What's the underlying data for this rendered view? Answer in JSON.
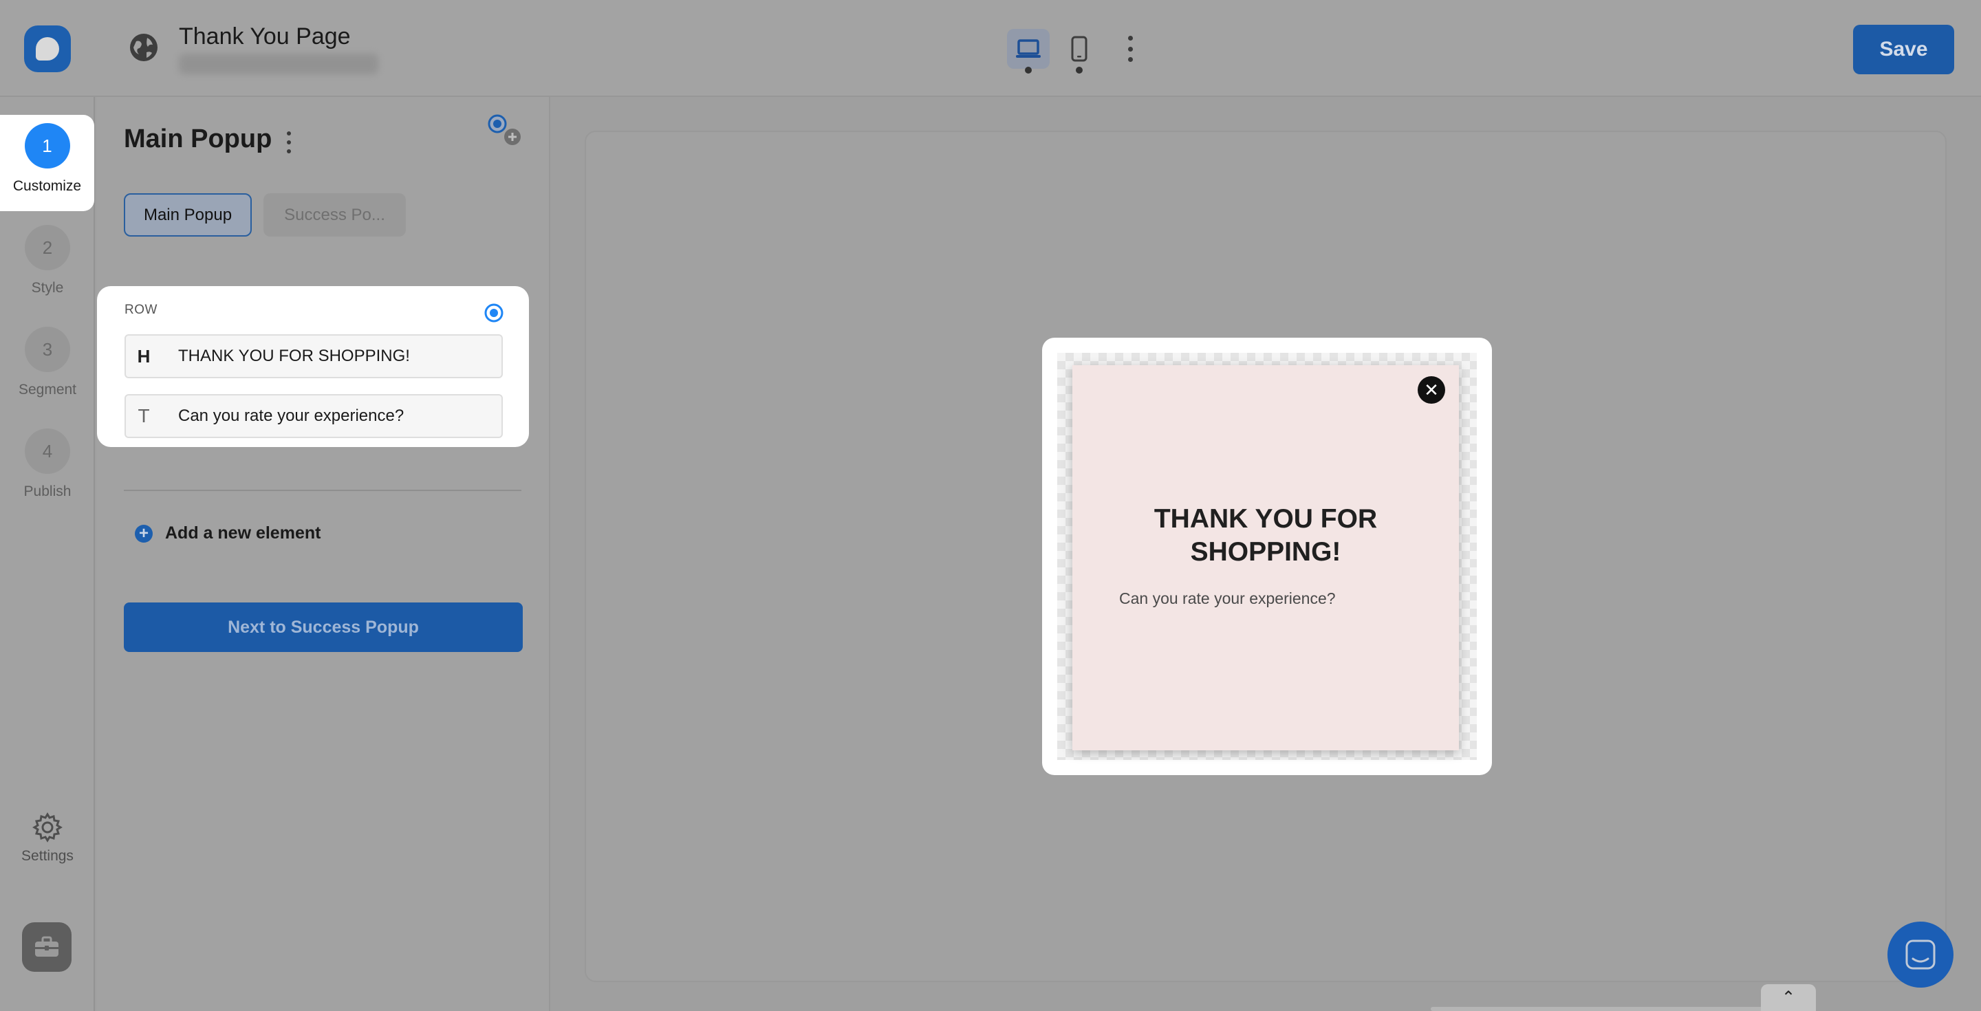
{
  "header": {
    "page_title": "Thank You Page",
    "page_subtitle": "",
    "save_label": "Save",
    "devices": [
      "desktop-icon",
      "mobile-icon"
    ]
  },
  "steps": [
    {
      "num": "1",
      "label": "Customize",
      "active": true
    },
    {
      "num": "2",
      "label": "Style",
      "active": false
    },
    {
      "num": "3",
      "label": "Segment",
      "active": false
    },
    {
      "num": "4",
      "label": "Publish",
      "active": false
    }
  ],
  "rail": {
    "settings_label": "Settings"
  },
  "panel": {
    "title": "Main Popup",
    "tabs": [
      {
        "label": "Main Popup",
        "active": true
      },
      {
        "label": "Success Po...",
        "active": false
      }
    ],
    "row": {
      "label": "ROW",
      "elements": [
        {
          "icon": "H",
          "text": "THANK YOU FOR SHOPPING!"
        },
        {
          "icon": "T",
          "text": "Can you rate your experience?"
        }
      ]
    },
    "add_element_label": "Add a new element",
    "next_button_label": "Next to Success Popup"
  },
  "preview": {
    "heading": "THANK YOU FOR SHOPPING!",
    "text": "Can you rate your experience?",
    "close_glyph": "✕"
  },
  "colors": {
    "accent": "#1c5aa6",
    "active_step": "#1f86f5",
    "popup_bg": "#f3e5e4"
  }
}
